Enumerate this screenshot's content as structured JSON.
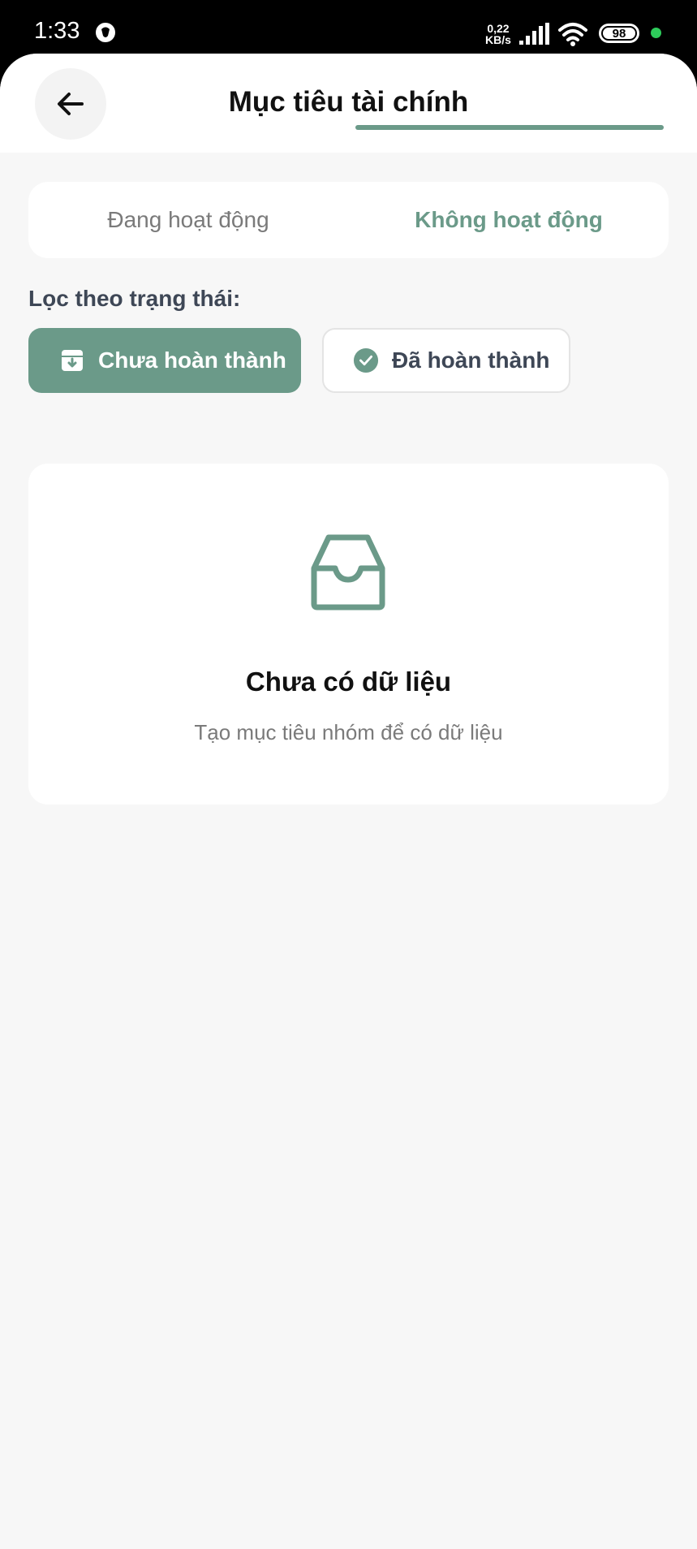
{
  "status_bar": {
    "time": "1:33",
    "net_speed_value": "0,22",
    "net_speed_unit": "KB/s",
    "battery": "98"
  },
  "header": {
    "title": "Mục tiêu tài chính"
  },
  "tabs": {
    "items": [
      {
        "label": "Đang hoạt động",
        "active": false
      },
      {
        "label": "Không hoạt động",
        "active": true
      }
    ]
  },
  "filter": {
    "label": "Lọc theo trạng thái:",
    "options": [
      {
        "label": "Chưa hoàn thành",
        "selected": true,
        "icon": "archive-icon"
      },
      {
        "label": "Đã hoàn thành",
        "selected": false,
        "icon": "check-circle-icon"
      }
    ]
  },
  "empty_state": {
    "icon": "inbox-icon",
    "title": "Chưa có dữ liệu",
    "subtitle": "Tạo mục tiêu nhóm để có dữ liệu"
  },
  "colors": {
    "accent": "#6B9A89",
    "background": "#F7F7F7"
  }
}
